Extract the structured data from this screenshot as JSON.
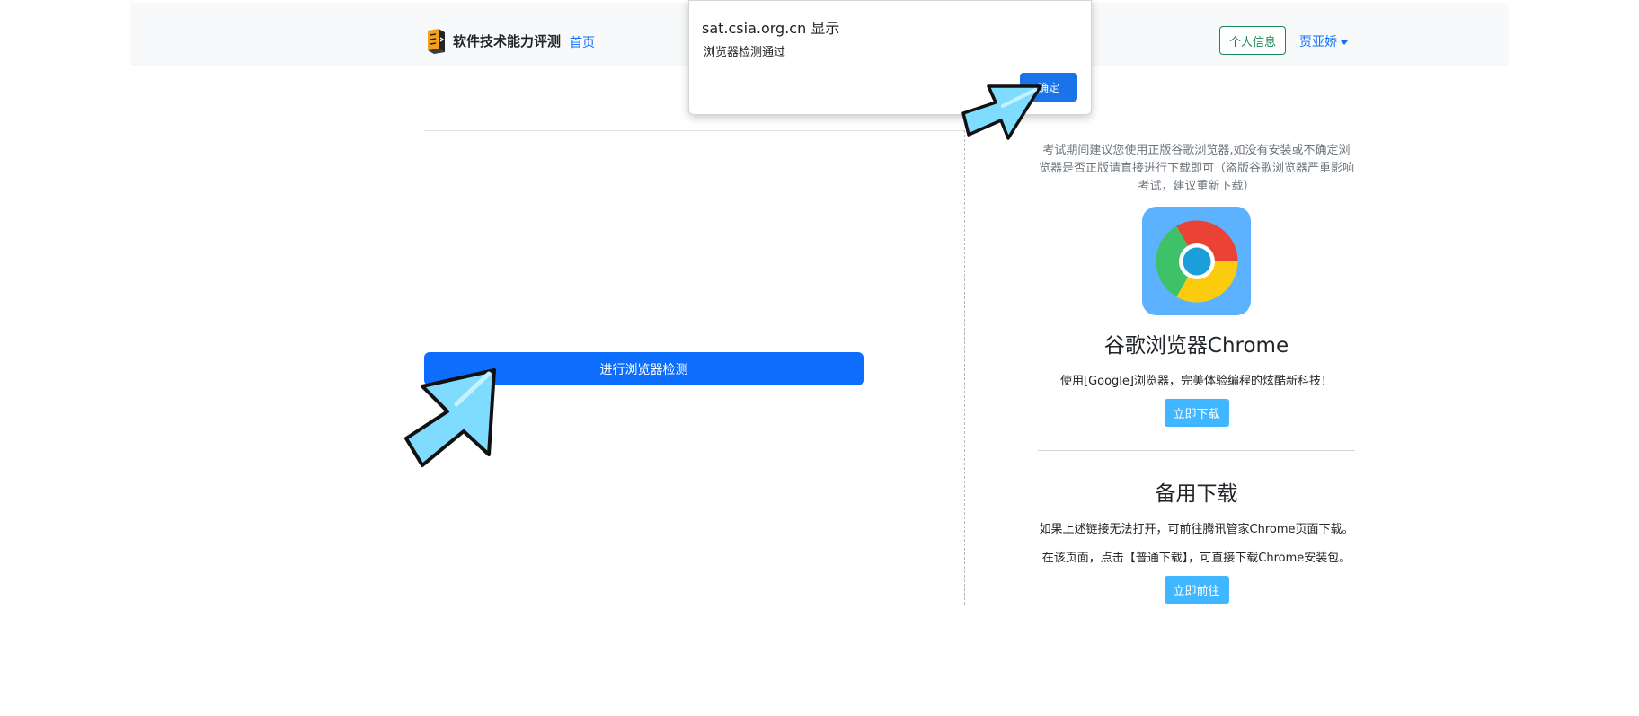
{
  "header": {
    "brand_text": "软件技术能力评测",
    "home_link": "首页",
    "profile_button": "个人信息",
    "user_name": "贾亚娇"
  },
  "main": {
    "detect_button": "进行浏览器检测"
  },
  "sidebar": {
    "advice": "考试期间建议您使用正版谷歌浏览器,如没有安装或不确定浏览器是否正版请直接进行下载即可（盗版谷歌浏览器严重影响考试，建议重新下载）",
    "chrome_title": "谷歌浏览器Chrome",
    "chrome_desc": "使用[Google]浏览器，完美体验编程的炫酷新科技！",
    "download_button": "立即下载",
    "backup_title": "备用下载",
    "backup_line1": "如果上述链接无法打开，可前往腾讯管家Chrome页面下载。",
    "backup_line2": "在该页面，点击【普通下载】，可直接下载Chrome安装包。",
    "goto_button": "立即前往"
  },
  "dialog": {
    "title": "sat.csia.org.cn 显示",
    "message": "浏览器检测通过",
    "ok_button": "确定"
  },
  "icons": {
    "brand_logo": "brand-logo-icon",
    "chrome": "chrome-icon",
    "pointer": "pointer-arrow-icon"
  },
  "colors": {
    "primary": "#0d6efd",
    "success": "#198754",
    "info": "#3fb6ff",
    "dialog_primary": "#1a73e8",
    "arrow_fill": "#7fdcff"
  }
}
